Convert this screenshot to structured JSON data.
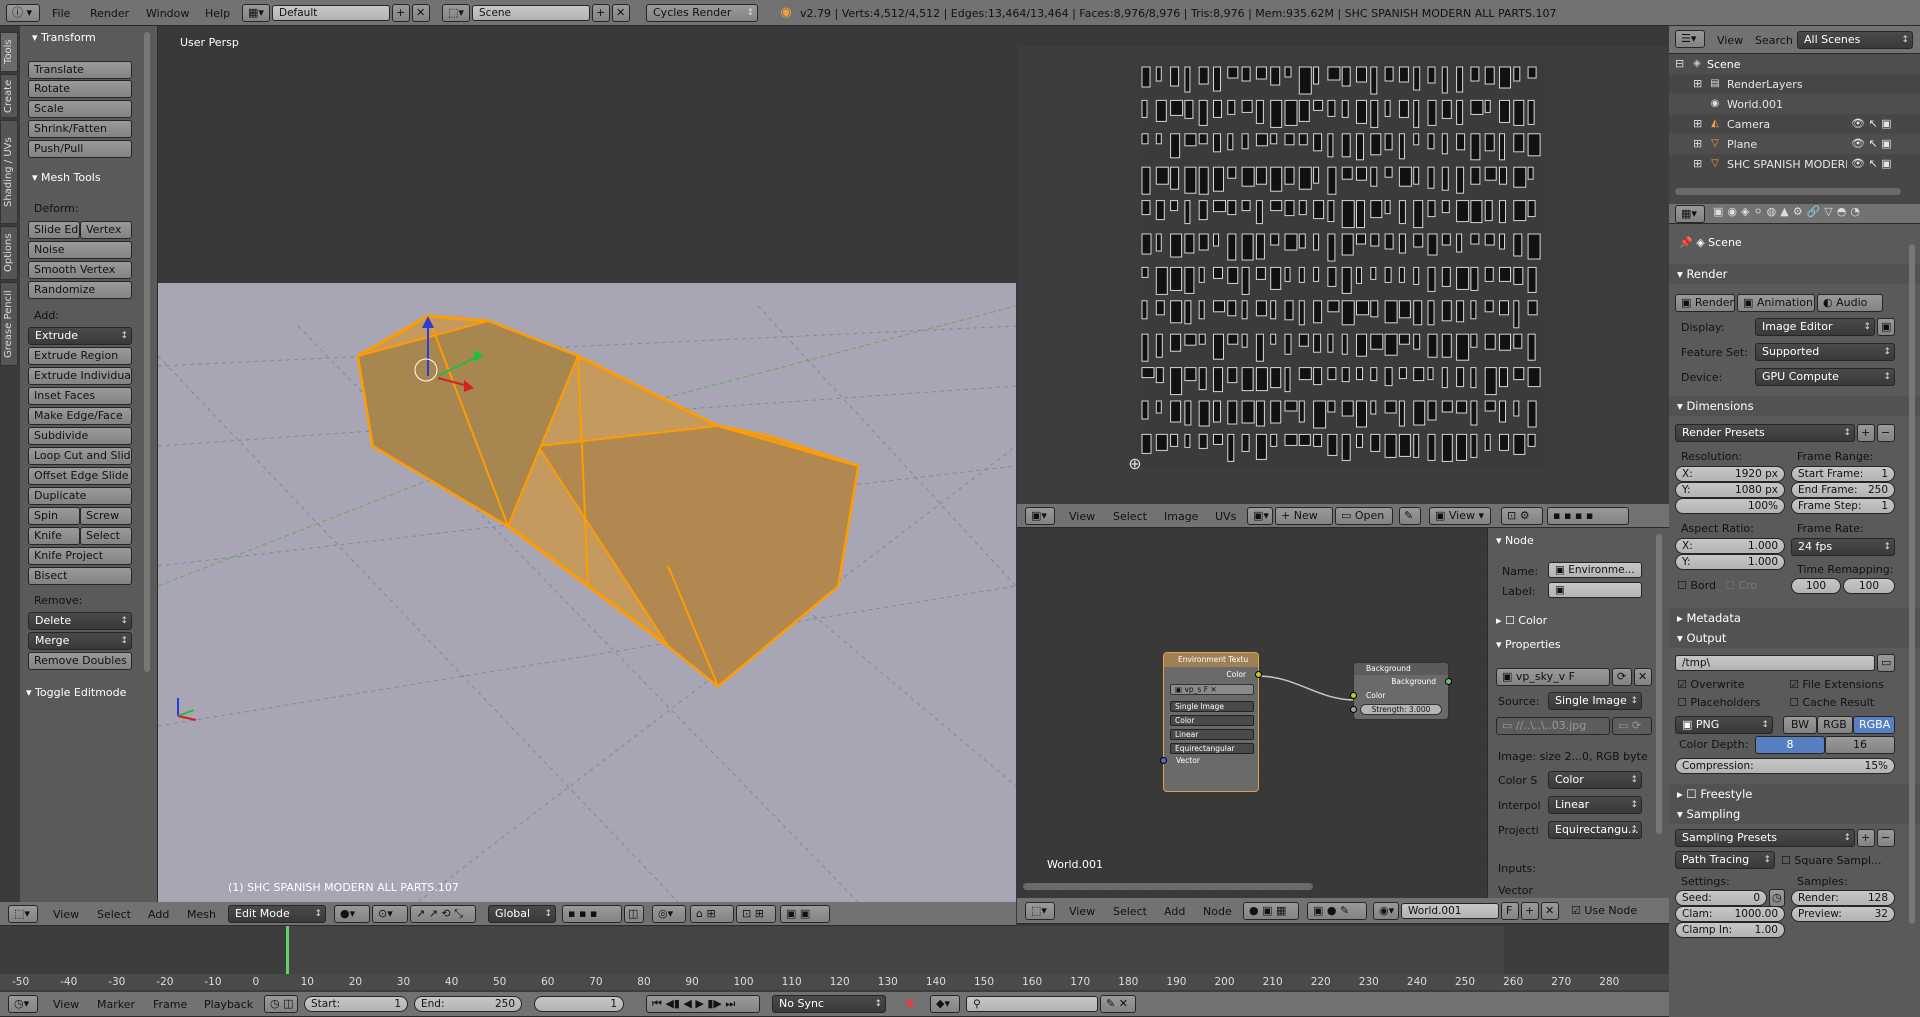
{
  "topbar": {
    "menus": [
      "File",
      "Render",
      "Window",
      "Help"
    ],
    "layout": "Default",
    "scene": "Scene",
    "engine": "Cycles Render",
    "stats": "v2.79 | Verts:4,512/4,512 | Edges:13,464/13,464 | Faces:8,976/8,976 | Tris:8,976 | Mem:935.62M | SHC SPANISH MODERN ALL PARTS.107"
  },
  "left_tabs": [
    "Tools",
    "Create",
    "Shading / UVs",
    "Options",
    "Grease Pencil"
  ],
  "toolshelf": {
    "transform_title": "Transform",
    "transform": [
      "Translate",
      "Rotate",
      "Scale",
      "Shrink/Fatten",
      "Push/Pull"
    ],
    "mesh_tools_title": "Mesh Tools",
    "deform_label": "Deform:",
    "slide_edge": "Slide Ed",
    "vertex": "Vertex",
    "deform": [
      "Noise",
      "Smooth Vertex",
      "Randomize"
    ],
    "add_label": "Add:",
    "extrude": "Extrude",
    "add": [
      "Extrude Region",
      "Extrude Individual",
      "Inset Faces",
      "Make Edge/Face",
      "Subdivide",
      "Loop Cut and Slide",
      "Offset Edge Slide",
      "Duplicate"
    ],
    "spin": "Spin",
    "screw": "Screw",
    "knife": "Knife",
    "select": "Select",
    "add2": [
      "Knife Project",
      "Bisect"
    ],
    "remove_label": "Remove:",
    "delete": "Delete",
    "merge": "Merge",
    "remove_doubles": "Remove Doubles",
    "toggle_editmode": "Toggle Editmode"
  },
  "viewport": {
    "label": "User Persp",
    "object_label": "(1) SHC SPANISH MODERN ALL PARTS.107",
    "menus": [
      "View",
      "Select",
      "Add",
      "Mesh"
    ],
    "mode": "Edit Mode",
    "orientation": "Global"
  },
  "image_editor": {
    "menus": [
      "View",
      "Select",
      "Image",
      "UVs"
    ],
    "new": "New",
    "open": "Open",
    "view": "View"
  },
  "node_editor": {
    "world_label": "World.001",
    "env_node": {
      "title": "Environment Textu",
      "out": "Color",
      "img": "vp_s",
      "opts": [
        "Single Image",
        "Color",
        "Linear",
        "Equirectangular"
      ],
      "in": "Vector"
    },
    "bg_node": {
      "title": "Background",
      "out": "Background",
      "in_color": "Color",
      "strength": "Strength: 3.000"
    },
    "menus": [
      "View",
      "Select",
      "Add",
      "Node"
    ],
    "world": "World.001",
    "f": "F",
    "use_nodes": "Use Node"
  },
  "node_panel": {
    "title": "Node",
    "name_label": "Name:",
    "name_value": "Environme...",
    "label_label": "Label:",
    "color_title": "Color",
    "props_title": "Properties",
    "image_name": "vp_sky_v",
    "f": "F",
    "source_label": "Source:",
    "source_value": "Single Image",
    "path": "//..\\..\\..03.jpg",
    "info": "Image: size 2...0, RGB byte",
    "colors_label": "Color S",
    "colors_value": "Color",
    "interp_label": "Interpol",
    "interp_value": "Linear",
    "proj_label": "Projecti",
    "proj_value": "Equirectangu...",
    "inputs_label": "Inputs:",
    "vector_label": "Vector"
  },
  "outliner": {
    "menus": [
      "View",
      "Search"
    ],
    "scenes": "All Scenes",
    "items": [
      {
        "label": "Scene",
        "indent": 0
      },
      {
        "label": "RenderLayers",
        "indent": 1
      },
      {
        "label": "World.001",
        "indent": 1
      },
      {
        "label": "Camera",
        "indent": 1
      },
      {
        "label": "Plane",
        "indent": 1
      },
      {
        "label": "SHC SPANISH MODERN",
        "indent": 1
      }
    ]
  },
  "properties": {
    "scene": "Scene",
    "render_title": "Render",
    "render_btn": "Render",
    "animation_btn": "Animation",
    "audio_btn": "Audio",
    "display_label": "Display:",
    "display_value": "Image Editor",
    "feature_label": "Feature Set:",
    "feature_value": "Supported",
    "device_label": "Device:",
    "device_value": "GPU Compute",
    "dimensions_title": "Dimensions",
    "render_presets": "Render Presets",
    "resolution_label": "Resolution:",
    "res_x": "X:",
    "res_x_val": "1920 px",
    "res_y": "Y:",
    "res_y_val": "1080 px",
    "res_pct": "100%",
    "frame_range_label": "Frame Range:",
    "start_label": "Start Frame:",
    "start_val": "1",
    "end_label": "End Frame:",
    "end_val": "250",
    "step_label": "Frame Step:",
    "step_val": "1",
    "aspect_label": "Aspect Ratio:",
    "asp_x": "X:",
    "asp_x_val": "1.000",
    "asp_y": "Y:",
    "asp_y_val": "1.000",
    "frame_rate_label": "Frame Rate:",
    "frame_rate": "24 fps",
    "time_remap_label": "Time Remapping:",
    "remap_old": "100",
    "remap_new": "100",
    "bord": "Bord",
    "cro": "Cro",
    "metadata_title": "Metadata",
    "output_title": "Output",
    "output_path": "/tmp\\",
    "overwrite": "Overwrite",
    "file_ext": "File Extensions",
    "placeholders": "Placeholders",
    "cache_result": "Cache Result",
    "format": "PNG",
    "bw": "BW",
    "rgb": "RGB",
    "rgba": "RGBA",
    "color_depth_label": "Color Depth:",
    "depth8": "8",
    "depth16": "16",
    "compression": "Compression:",
    "compression_val": "15%",
    "freestyle_title": "Freestyle",
    "sampling_title": "Sampling",
    "sampling_presets": "Sampling Presets",
    "path_tracing": "Path Tracing",
    "square_samples": "Square Sampl...",
    "settings_label": "Settings:",
    "samples_label": "Samples:",
    "seed_label": "Seed:",
    "seed_val": "0",
    "render_s_label": "Render:",
    "render_s_val": "128",
    "clamp_label": "Clam:",
    "clamp_val": "1000.00",
    "preview_label": "Preview:",
    "preview_val": "32",
    "clamp_in_label": "Clamp In:",
    "clamp_in_val": "1.00"
  },
  "timeline": {
    "ruler": [
      "-50",
      "-40",
      "-30",
      "-20",
      "-10",
      "0",
      "10",
      "20",
      "30",
      "40",
      "50",
      "60",
      "70",
      "80",
      "90",
      "100",
      "110",
      "120",
      "130",
      "140",
      "150",
      "160",
      "170",
      "180",
      "190",
      "200",
      "210",
      "220",
      "230",
      "240",
      "250",
      "260",
      "270",
      "280"
    ],
    "menus": [
      "View",
      "Marker",
      "Frame",
      "Playback"
    ],
    "start_label": "Start:",
    "start": "1",
    "end_label": "End:",
    "end": "250",
    "current": "1",
    "sync": "No Sync"
  }
}
